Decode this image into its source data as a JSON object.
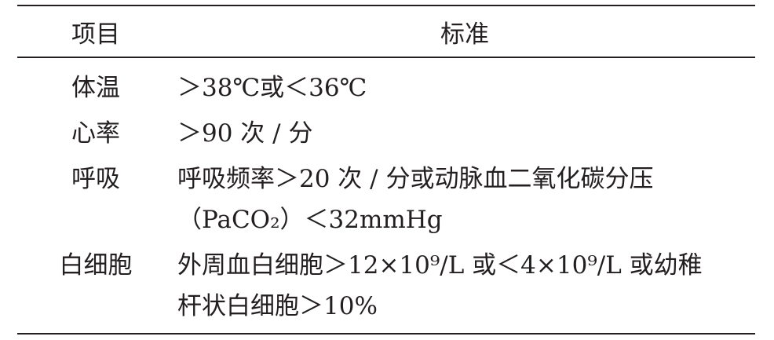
{
  "table": {
    "headers": {
      "item": "项目",
      "standard": "标准"
    },
    "rows": [
      {
        "item": "体温",
        "standard": [
          "＞38℃或＜36℃"
        ]
      },
      {
        "item": "心率",
        "standard": [
          "＞90 次 / 分"
        ]
      },
      {
        "item": "呼吸",
        "standard": [
          "呼吸频率＞20 次 / 分或动脉血二氧化碳分压",
          "（PaCO₂）＜32mmHg"
        ]
      },
      {
        "item": "白细胞",
        "standard": [
          "外周血白细胞＞12×10⁹/L 或＜4×10⁹/L 或幼稚",
          "杆状白细胞＞10%"
        ]
      }
    ]
  }
}
